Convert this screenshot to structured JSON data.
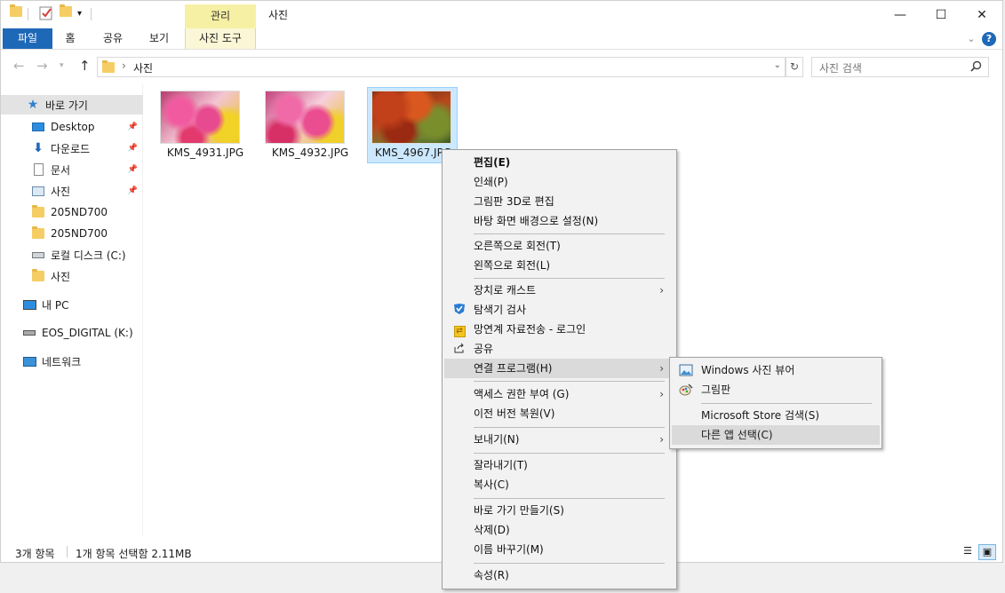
{
  "window": {
    "context_tab_label": "관리",
    "title": "사진",
    "controls": {
      "minimize": "—",
      "maximize": "☐",
      "close": "✕"
    }
  },
  "ribbon": {
    "tabs": [
      "파일",
      "홈",
      "공유",
      "보기",
      "사진 도구"
    ],
    "help": "?"
  },
  "address": {
    "sep": "›",
    "path": "사진",
    "search_placeholder": "사진 검색"
  },
  "nav": {
    "quick_access": "바로 가기",
    "items": [
      {
        "label": "Desktop",
        "icon": "desktop-icon",
        "pinned": true
      },
      {
        "label": "다운로드",
        "icon": "download-icon",
        "pinned": true
      },
      {
        "label": "문서",
        "icon": "document-icon",
        "pinned": true
      },
      {
        "label": "사진",
        "icon": "pictures-icon",
        "pinned": true
      },
      {
        "label": "205ND700",
        "icon": "folder-icon",
        "pinned": false
      },
      {
        "label": "205ND700",
        "icon": "folder-icon",
        "pinned": false
      },
      {
        "label": "로컬 디스크 (C:)",
        "icon": "drive-icon",
        "pinned": false
      },
      {
        "label": "사진",
        "icon": "folder-icon",
        "pinned": false
      }
    ],
    "this_pc": "내 PC",
    "eos": "EOS_DIGITAL (K:)",
    "network": "네트워크"
  },
  "files": [
    {
      "name": "KMS_4931.JPG",
      "selected": false
    },
    {
      "name": "KMS_4932.JPG",
      "selected": false
    },
    {
      "name": "KMS_4967.JPG",
      "selected": true
    }
  ],
  "status": {
    "count": "3개 항목",
    "selection": "1개 항목 선택함 2.11MB"
  },
  "context_menu": {
    "edit": "편집(E)",
    "print": "인쇄(P)",
    "paint3d": "그림판 3D로 편집",
    "wallpaper": "바탕 화면 배경으로 설정(N)",
    "rotate_right": "오른쪽으로 회전(T)",
    "rotate_left": "왼쪽으로 회전(L)",
    "cast": "장치로 캐스트",
    "scan": "탐색기 검사",
    "upload": "망연계 자료전송 - 로그인",
    "share": "공유",
    "open_with": "연결 프로그램(H)",
    "access": "액세스 권한 부여 (G)",
    "restore": "이전 버전 복원(V)",
    "send_to": "보내기(N)",
    "cut": "잘라내기(T)",
    "copy": "복사(C)",
    "shortcut": "바로 가기 만들기(S)",
    "delete": "삭제(D)",
    "rename": "이름 바꾸기(M)",
    "properties": "속성(R)"
  },
  "submenu": {
    "photo_viewer": "Windows 사진 뷰어",
    "paint": "그림판",
    "store": "Microsoft Store 검색(S)",
    "other": "다른 앱 선택(C)"
  }
}
